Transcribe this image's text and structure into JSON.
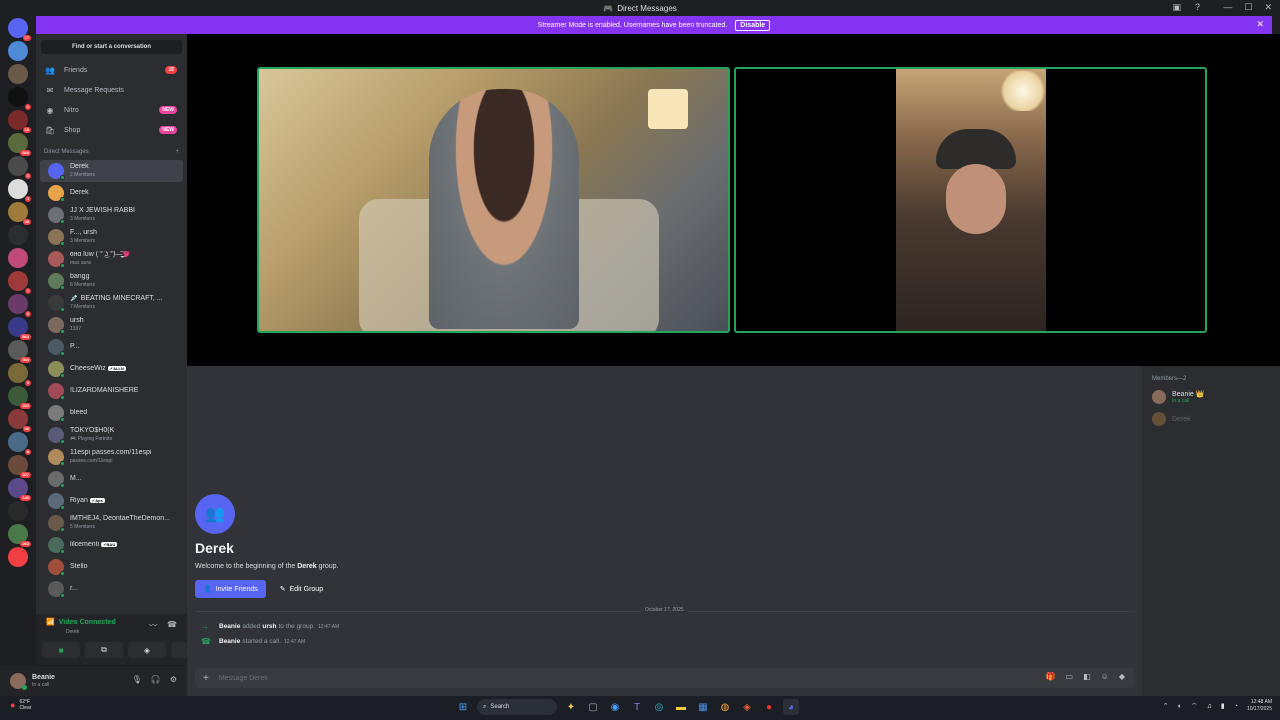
{
  "window": {
    "title": "Direct Messages"
  },
  "streamer_bar": {
    "text": "Streamer Mode is enabled. Usernames have been truncated.",
    "disable_label": "Disable"
  },
  "sidebar": {
    "search_label": "Find or start a conversation",
    "nav": [
      {
        "label": "Friends",
        "badge": "16",
        "icon": "friends-icon"
      },
      {
        "label": "Message Requests",
        "badge": "",
        "icon": "envelope-icon"
      },
      {
        "label": "Nitro",
        "badge": "NEW",
        "icon": "nitro-icon"
      },
      {
        "label": "Shop",
        "badge": "NEW",
        "icon": "shop-icon"
      }
    ],
    "dm_header": "Direct Messages",
    "dms": [
      {
        "name": "Derek",
        "sub": "2 Members",
        "active": true,
        "color": "#5865f2"
      },
      {
        "name": "Derek",
        "sub": "",
        "color": "#e8a34b"
      },
      {
        "name": "JJ X JEWISH RABBI",
        "sub": "3 Members",
        "color": "#6d6f78"
      },
      {
        "name": "F..., ursh",
        "sub": "3 Members",
        "color": "#8a7356"
      },
      {
        "name": "ɞʜɑ lʊw ( ͡° ͜ʖ ͡°)—̳͟͞͞💗",
        "sub": "max aura",
        "color": "#a85a5a"
      },
      {
        "name": "bangg",
        "sub": "8 Members",
        "color": "#5f7a5a"
      },
      {
        "name": "💉 BEATING MINECRAFT, ...",
        "sub": "7 Members",
        "color": "#3a3a3a"
      },
      {
        "name": "ursh",
        "sub": "1337",
        "color": "#7d6a5f"
      },
      {
        "name": "P...",
        "sub": "",
        "color": "#4a5a66"
      },
      {
        "name": "CheeseWiz",
        "sub": "",
        "tag": "✔ALLN",
        "color": "#8a8f5a"
      },
      {
        "name": "!LIZARDMANISHERE",
        "sub": "",
        "color": "#a04a5a"
      },
      {
        "name": "bleed",
        "sub": "",
        "color": "#7a7a7a"
      },
      {
        "name": "TOKYO$H0(K",
        "sub": "🎮 Playing Fortnite",
        "color": "#5a5a7a"
      },
      {
        "name": "11espi passes.com/11espi",
        "sub": "passes.com/11espi",
        "color": "#b08a5a"
      },
      {
        "name": "M...",
        "sub": "",
        "color": "#6a6a6a"
      },
      {
        "name": "Riyan",
        "sub": "",
        "tag": "✔Apx",
        "color": "#5a6a7a"
      },
      {
        "name": "IMTHEJ4, DeontaeTheDemon...",
        "sub": "5 Members",
        "color": "#6a5a4a"
      },
      {
        "name": "lilcementi",
        "sub": "",
        "tag": "✔BAU",
        "color": "#4a6a5a"
      },
      {
        "name": "Stello",
        "sub": "",
        "color": "#a0503a"
      },
      {
        "name": "r...",
        "sub": "",
        "color": "#5a5a5a"
      }
    ]
  },
  "voice": {
    "status": "Video Connected",
    "channel": "Derek"
  },
  "user": {
    "name": "Beanie",
    "status": "In a call"
  },
  "members": {
    "header": "Members—2",
    "list": [
      {
        "name": "Beanie 👑",
        "sub": "In a call"
      },
      {
        "name": "Derek",
        "sub": ""
      }
    ]
  },
  "chat": {
    "group_title": "Derek",
    "welcome_prefix": "Welcome to the beginning of the ",
    "welcome_name": "Derek",
    "welcome_suffix": " group.",
    "invite_label": "Invite Friends",
    "edit_label": "Edit Group",
    "date_divider": "October 17, 2025",
    "events": [
      {
        "actor": "Beanie",
        "verb": "added",
        "target": "ursh",
        "rest": "to the group.",
        "time": "12:47 AM"
      },
      {
        "actor": "Beanie",
        "verb": "started a call.",
        "target": "",
        "rest": "",
        "time": "12:47 AM"
      }
    ],
    "composer_placeholder": "Message Derek"
  },
  "taskbar": {
    "weather_temp": "62°F",
    "weather_cond": "Clear",
    "search_label": "Search",
    "time": "12:48 AM",
    "date": "10/17/2025"
  }
}
